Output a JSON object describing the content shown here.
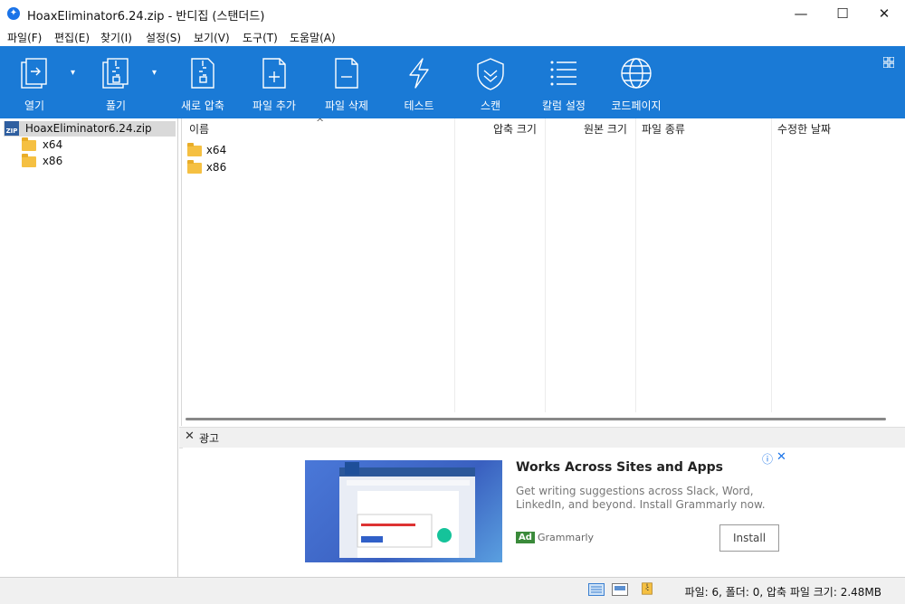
{
  "window": {
    "title": "HoaxEliminator6.24.zip - 반디집 (스탠더드)"
  },
  "menu": [
    {
      "label": "파일(F)"
    },
    {
      "label": "편집(E)"
    },
    {
      "label": "찾기(I)"
    },
    {
      "label": "설정(S)"
    },
    {
      "label": "보기(V)"
    },
    {
      "label": "도구(T)"
    },
    {
      "label": "도움말(A)"
    }
  ],
  "toolbar": {
    "open": "열기",
    "extract": "풀기",
    "new_archive": "새로 압축",
    "add_files": "파일 추가",
    "delete_files": "파일 삭제",
    "test": "테스트",
    "scan": "스캔",
    "column_settings": "칼럼 설정",
    "codepage": "코드페이지"
  },
  "tree": {
    "root": "HoaxEliminator6.24.zip",
    "root_icon_text": "ZIP",
    "children": [
      {
        "label": "x64"
      },
      {
        "label": "x86"
      }
    ]
  },
  "filelist": {
    "columns": {
      "name": "이름",
      "compressed": "압축 크기",
      "original": "원본 크기",
      "type": "파일 종류",
      "modified": "수정한 날짜"
    },
    "rows": [
      {
        "name": "x64"
      },
      {
        "name": "x86"
      }
    ]
  },
  "ad": {
    "bar_label": "광고",
    "title": "Works Across Sites and Apps",
    "description": "Get writing suggestions across Slack, Word, LinkedIn, and beyond. Install Grammarly now.",
    "badge": "Ad",
    "brand": "Grammarly",
    "install": "Install"
  },
  "status": {
    "text": "파일: 6, 폴더: 0, 압축 파일 크기: 2.48MB"
  },
  "colors": {
    "toolbar_bg": "#1a7ad6",
    "accent": "#1a73e8"
  }
}
